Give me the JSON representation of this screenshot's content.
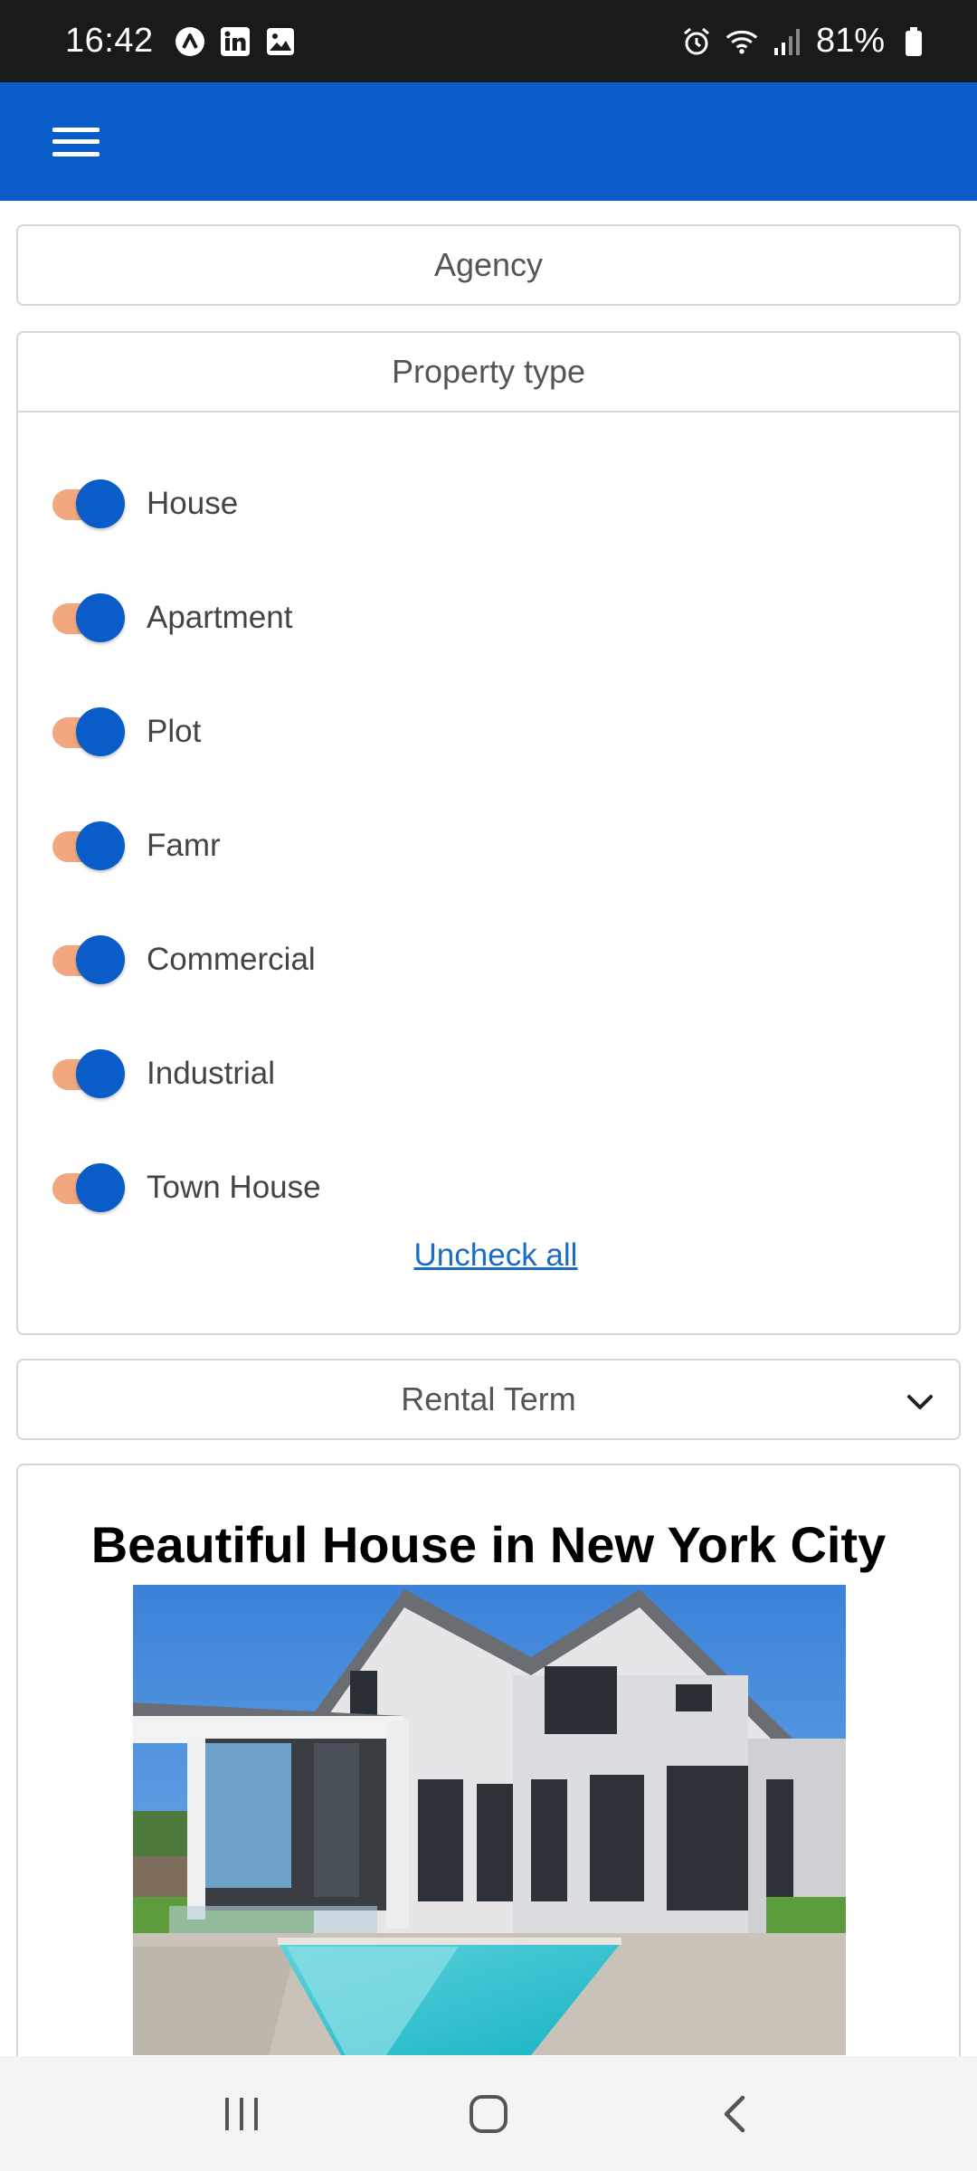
{
  "status_bar": {
    "time": "16:42",
    "battery": "81%",
    "left_icons": [
      "a-icon",
      "linkedin-icon",
      "gallery-icon"
    ],
    "right_icons": [
      "alarm-icon",
      "wifi-icon",
      "signal-icon",
      "battery-icon"
    ]
  },
  "app_bar": {
    "menu_icon": "hamburger-menu-icon",
    "color": "#0a5dc8"
  },
  "filters": {
    "agency_label": "Agency",
    "property_type_label": "Property type",
    "property_types": [
      {
        "label": "House",
        "checked": true
      },
      {
        "label": "Apartment",
        "checked": true
      },
      {
        "label": "Plot",
        "checked": true
      },
      {
        "label": "Famr",
        "checked": true
      },
      {
        "label": "Commercial",
        "checked": true
      },
      {
        "label": "Industrial",
        "checked": true
      },
      {
        "label": "Town House",
        "checked": true
      }
    ],
    "uncheck_all_label": "Uncheck all",
    "rental_term_label": "Rental Term",
    "rental_term_icon": "chevron-down-icon"
  },
  "listing": {
    "title": "Beautiful House in New York City",
    "image": "house-with-pool-photo"
  },
  "colors": {
    "toggle_track": "#f2a77f",
    "toggle_thumb": "#0a5dc8",
    "link": "#1a6cc7"
  },
  "nav_bar": {
    "buttons": [
      "recent-apps-icon",
      "home-icon",
      "back-icon"
    ]
  }
}
